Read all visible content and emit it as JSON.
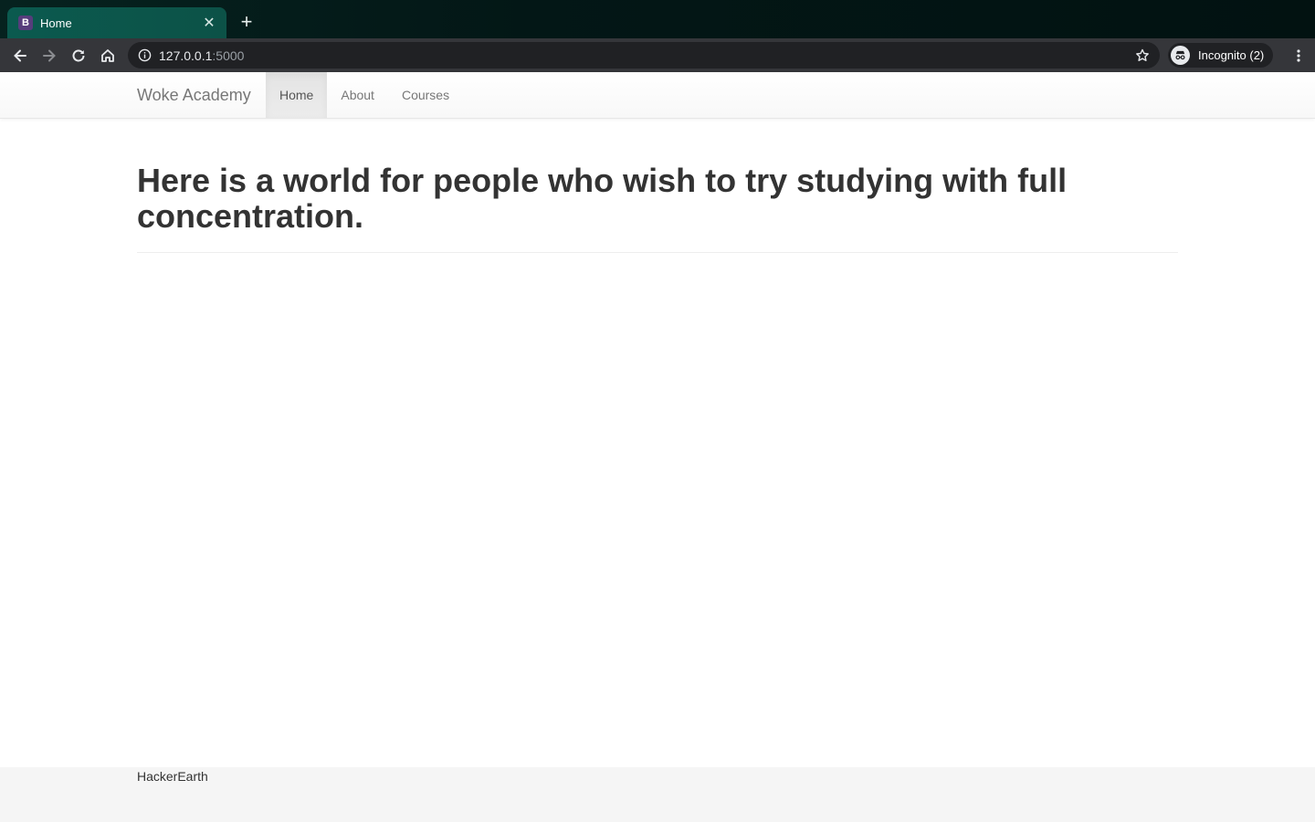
{
  "browser": {
    "tab_title": "Home",
    "tab_favicon_letter": "B",
    "url_host": "127.0.0.1",
    "url_port": ":5000",
    "incognito_label": "Incognito (2)"
  },
  "navbar": {
    "brand": "Woke Academy",
    "links": [
      {
        "label": "Home",
        "active": true
      },
      {
        "label": "About",
        "active": false
      },
      {
        "label": "Courses",
        "active": false
      }
    ]
  },
  "main": {
    "headline": "Here is a world for people who wish to try studying with full concentration."
  },
  "footer": {
    "text": "HackerEarth"
  },
  "colors": {
    "tab_active": "#0b5a4f",
    "toolbar": "#35363a",
    "navbar_text": "#777777",
    "headline": "#333333",
    "footer_bg": "#f5f5f5"
  }
}
